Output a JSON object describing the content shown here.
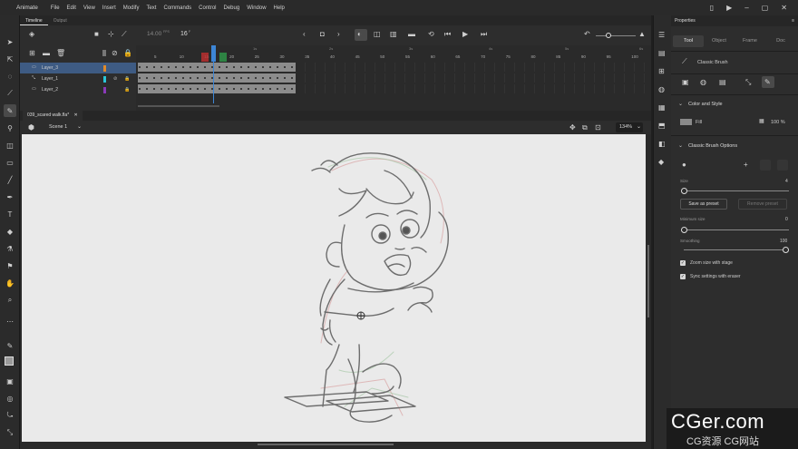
{
  "app": {
    "name": "Animate"
  },
  "menu": [
    "File",
    "Edit",
    "View",
    "Insert",
    "Modify",
    "Text",
    "Commands",
    "Control",
    "Debug",
    "Window",
    "Help"
  ],
  "timeline": {
    "tabs": [
      "Timeline",
      "Output"
    ],
    "fps": "14.00",
    "fps_unit": "FPS",
    "frame": "16",
    "frame_unit": "F",
    "ruler_labels": [
      "1s",
      "2s",
      "3s",
      "4s",
      "5s",
      "6s",
      "7s"
    ],
    "ruler_numbers": [
      "5",
      "10",
      "15",
      "20",
      "25",
      "30",
      "35",
      "40",
      "45",
      "50",
      "55",
      "60",
      "65",
      "70",
      "75",
      "80",
      "85",
      "90",
      "95",
      "100"
    ],
    "layers": [
      {
        "name": "Layer_3",
        "color": "#e08a2a",
        "selected": true
      },
      {
        "name": "Layer_1",
        "color": "#2ac6d8",
        "selected": false
      },
      {
        "name": "Layer_2",
        "color": "#8a3ab8",
        "selected": false
      }
    ]
  },
  "document": {
    "tab": "039_scared walk.fla*",
    "scene": "Scene 1",
    "zoom": "134%"
  },
  "properties": {
    "title": "Properties",
    "tabs": [
      "Tool",
      "Object",
      "Frame",
      "Doc"
    ],
    "tool_name": "Classic Brush",
    "color_section": "Color and Style",
    "fill_label": "Fill",
    "fill_alpha": "100 %",
    "brush_section": "Classic Brush Options",
    "size_label": "Size",
    "size_value": "4",
    "save_preset": "Save as preset",
    "remove_preset": "Remove preset",
    "min_size_label": "Minimum size",
    "min_size_value": "0",
    "smoothing_label": "Smoothing",
    "smoothing_value": "100",
    "zoom_size_label": "Zoom size with stage",
    "sync_label": "Sync settings with eraser"
  },
  "watermark": {
    "main": "CGer.com",
    "sub": "CG资源 CG网站"
  }
}
